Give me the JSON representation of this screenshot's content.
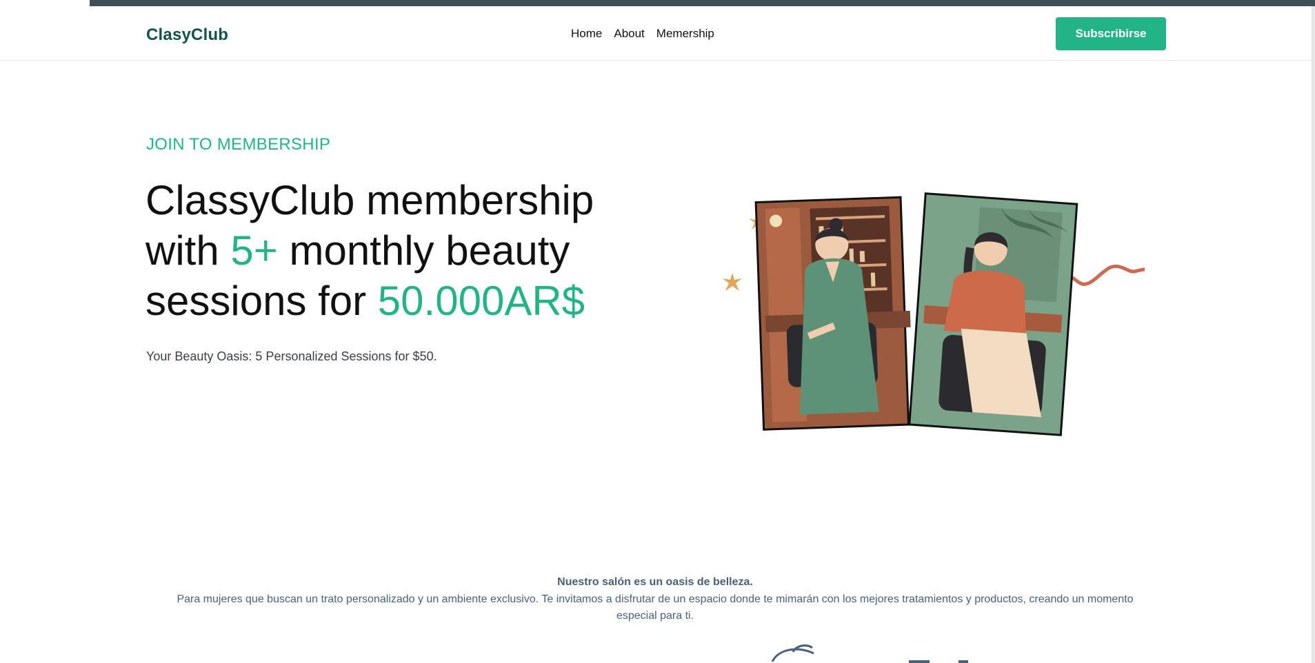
{
  "brand": {
    "name": "ClasyClub",
    "accent_color": "#22b487",
    "dark_color": "#12524a"
  },
  "nav": {
    "items": [
      {
        "label": "Home"
      },
      {
        "label": "About"
      },
      {
        "label": "Memership"
      }
    ],
    "cta_label": "Subscribirse"
  },
  "hero": {
    "eyebrow": "JOIN TO MEMBERSHIP",
    "headline_part1": "ClassyClub membership with ",
    "headline_accent1": "5+",
    "headline_part2": " monthly beauty sessions for ",
    "headline_accent2": "50.000AR$",
    "subtext": "Your Beauty Oasis: 5 Personalized Sessions for $50."
  },
  "about": {
    "title": "Nuestro salón es un oasis de belleza.",
    "body": "Para mujeres que buscan un trato personalizado y un ambiente exclusivo. Te invitamos a disfrutar de un espacio donde te mimarán con los mejores tratamientos y productos, creando un momento especial para ti."
  },
  "icons": [
    "star-icon",
    "squiggle-decoration"
  ]
}
